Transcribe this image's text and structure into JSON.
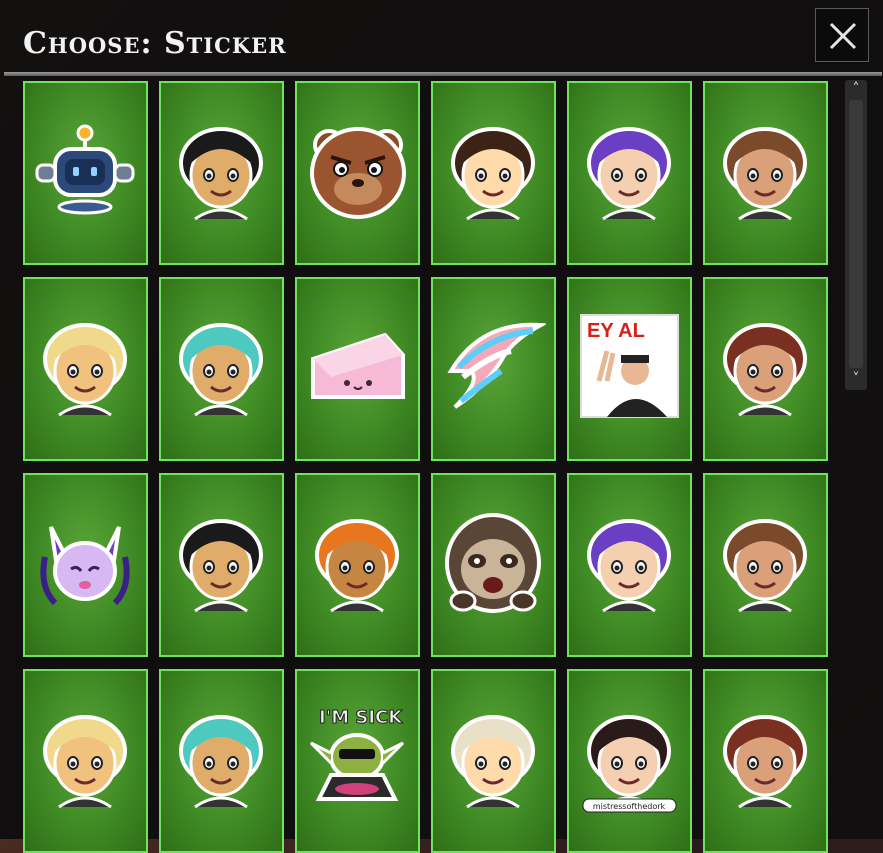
{
  "header": {
    "title": "Choose: Sticker"
  },
  "close_button": {
    "icon": "close-icon"
  },
  "scrollbar": {
    "up_icon": "chevron-up-icon",
    "down_icon": "chevron-down-icon",
    "up_glyph": "˄",
    "down_glyph": "˅"
  },
  "stickers": [
    {
      "name": "robot-sticker",
      "kind": "robot"
    },
    {
      "name": "headband-sunglasses-sticker",
      "kind": "face"
    },
    {
      "name": "angry-bear-sticker",
      "kind": "bear"
    },
    {
      "name": "dark-hair-woman-knife-sticker",
      "kind": "face"
    },
    {
      "name": "orange-hair-knife-sticker",
      "kind": "face"
    },
    {
      "name": "flexing-woman-sticker",
      "kind": "face"
    },
    {
      "name": "purple-hair-laugh-sticker",
      "kind": "face"
    },
    {
      "name": "squint-face-sticker",
      "kind": "face"
    },
    {
      "name": "cake-slice-sticker",
      "kind": "cake"
    },
    {
      "name": "feather-flag-sticker",
      "kind": "feather"
    },
    {
      "name": "peace-sign-photo-sticker",
      "kind": "photo",
      "text": "EY AL"
    },
    {
      "name": "crown-woman-sticker",
      "kind": "face"
    },
    {
      "name": "purple-demon-sticker",
      "kind": "demon"
    },
    {
      "name": "blonde-wave-sticker",
      "kind": "face"
    },
    {
      "name": "teal-hair-orb-sticker",
      "kind": "face"
    },
    {
      "name": "sloth-sticker",
      "kind": "sloth"
    },
    {
      "name": "smiling-woman-photo-sticker",
      "kind": "face"
    },
    {
      "name": "bearded-man-sticker",
      "kind": "face"
    },
    {
      "name": "teal-hair-cute-sticker",
      "kind": "face"
    },
    {
      "name": "witch-hat-sticker",
      "kind": "face"
    },
    {
      "name": "goblin-im-sick-sticker",
      "kind": "goblin",
      "text": "I'M SICK"
    },
    {
      "name": "blonde-cat-sticker",
      "kind": "face"
    },
    {
      "name": "mistressofthedork-sticker",
      "kind": "face",
      "text": "mistressofthedork"
    },
    {
      "name": "music-dance-sticker",
      "kind": "face"
    }
  ],
  "colors": {
    "tile_border": "#6fe35b",
    "tile_bg": "#3f8a24",
    "panel_bg": "#0c0c0e",
    "title": "#f2f2f2"
  }
}
